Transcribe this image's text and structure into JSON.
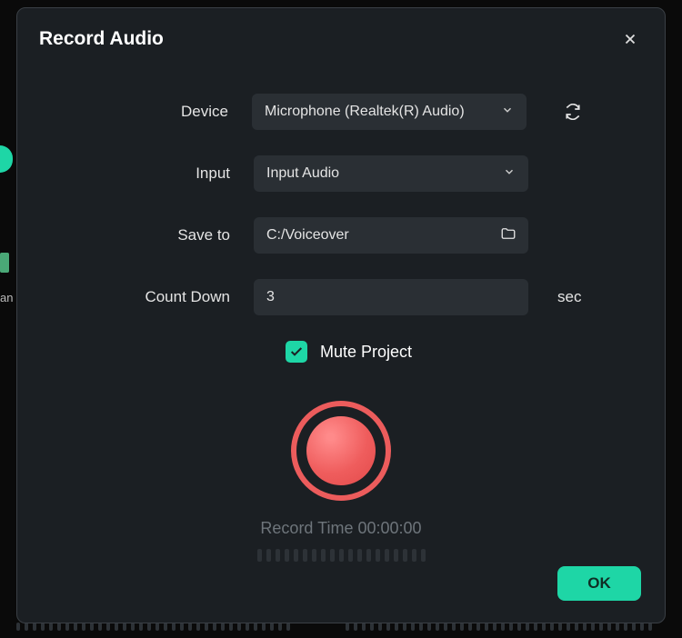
{
  "dialog": {
    "title": "Record Audio",
    "ok": "OK"
  },
  "labels": {
    "device": "Device",
    "input": "Input",
    "save_to": "Save to",
    "count_down": "Count Down",
    "sec": "sec",
    "mute": "Mute Project"
  },
  "values": {
    "device": "Microphone (Realtek(R) Audio)",
    "input": "Input Audio",
    "save_path": "C:/Voiceover",
    "countdown": "3"
  },
  "record": {
    "time_label": "Record Time",
    "time_value": "00:00:00"
  },
  "bg": {
    "fragment": "an"
  }
}
